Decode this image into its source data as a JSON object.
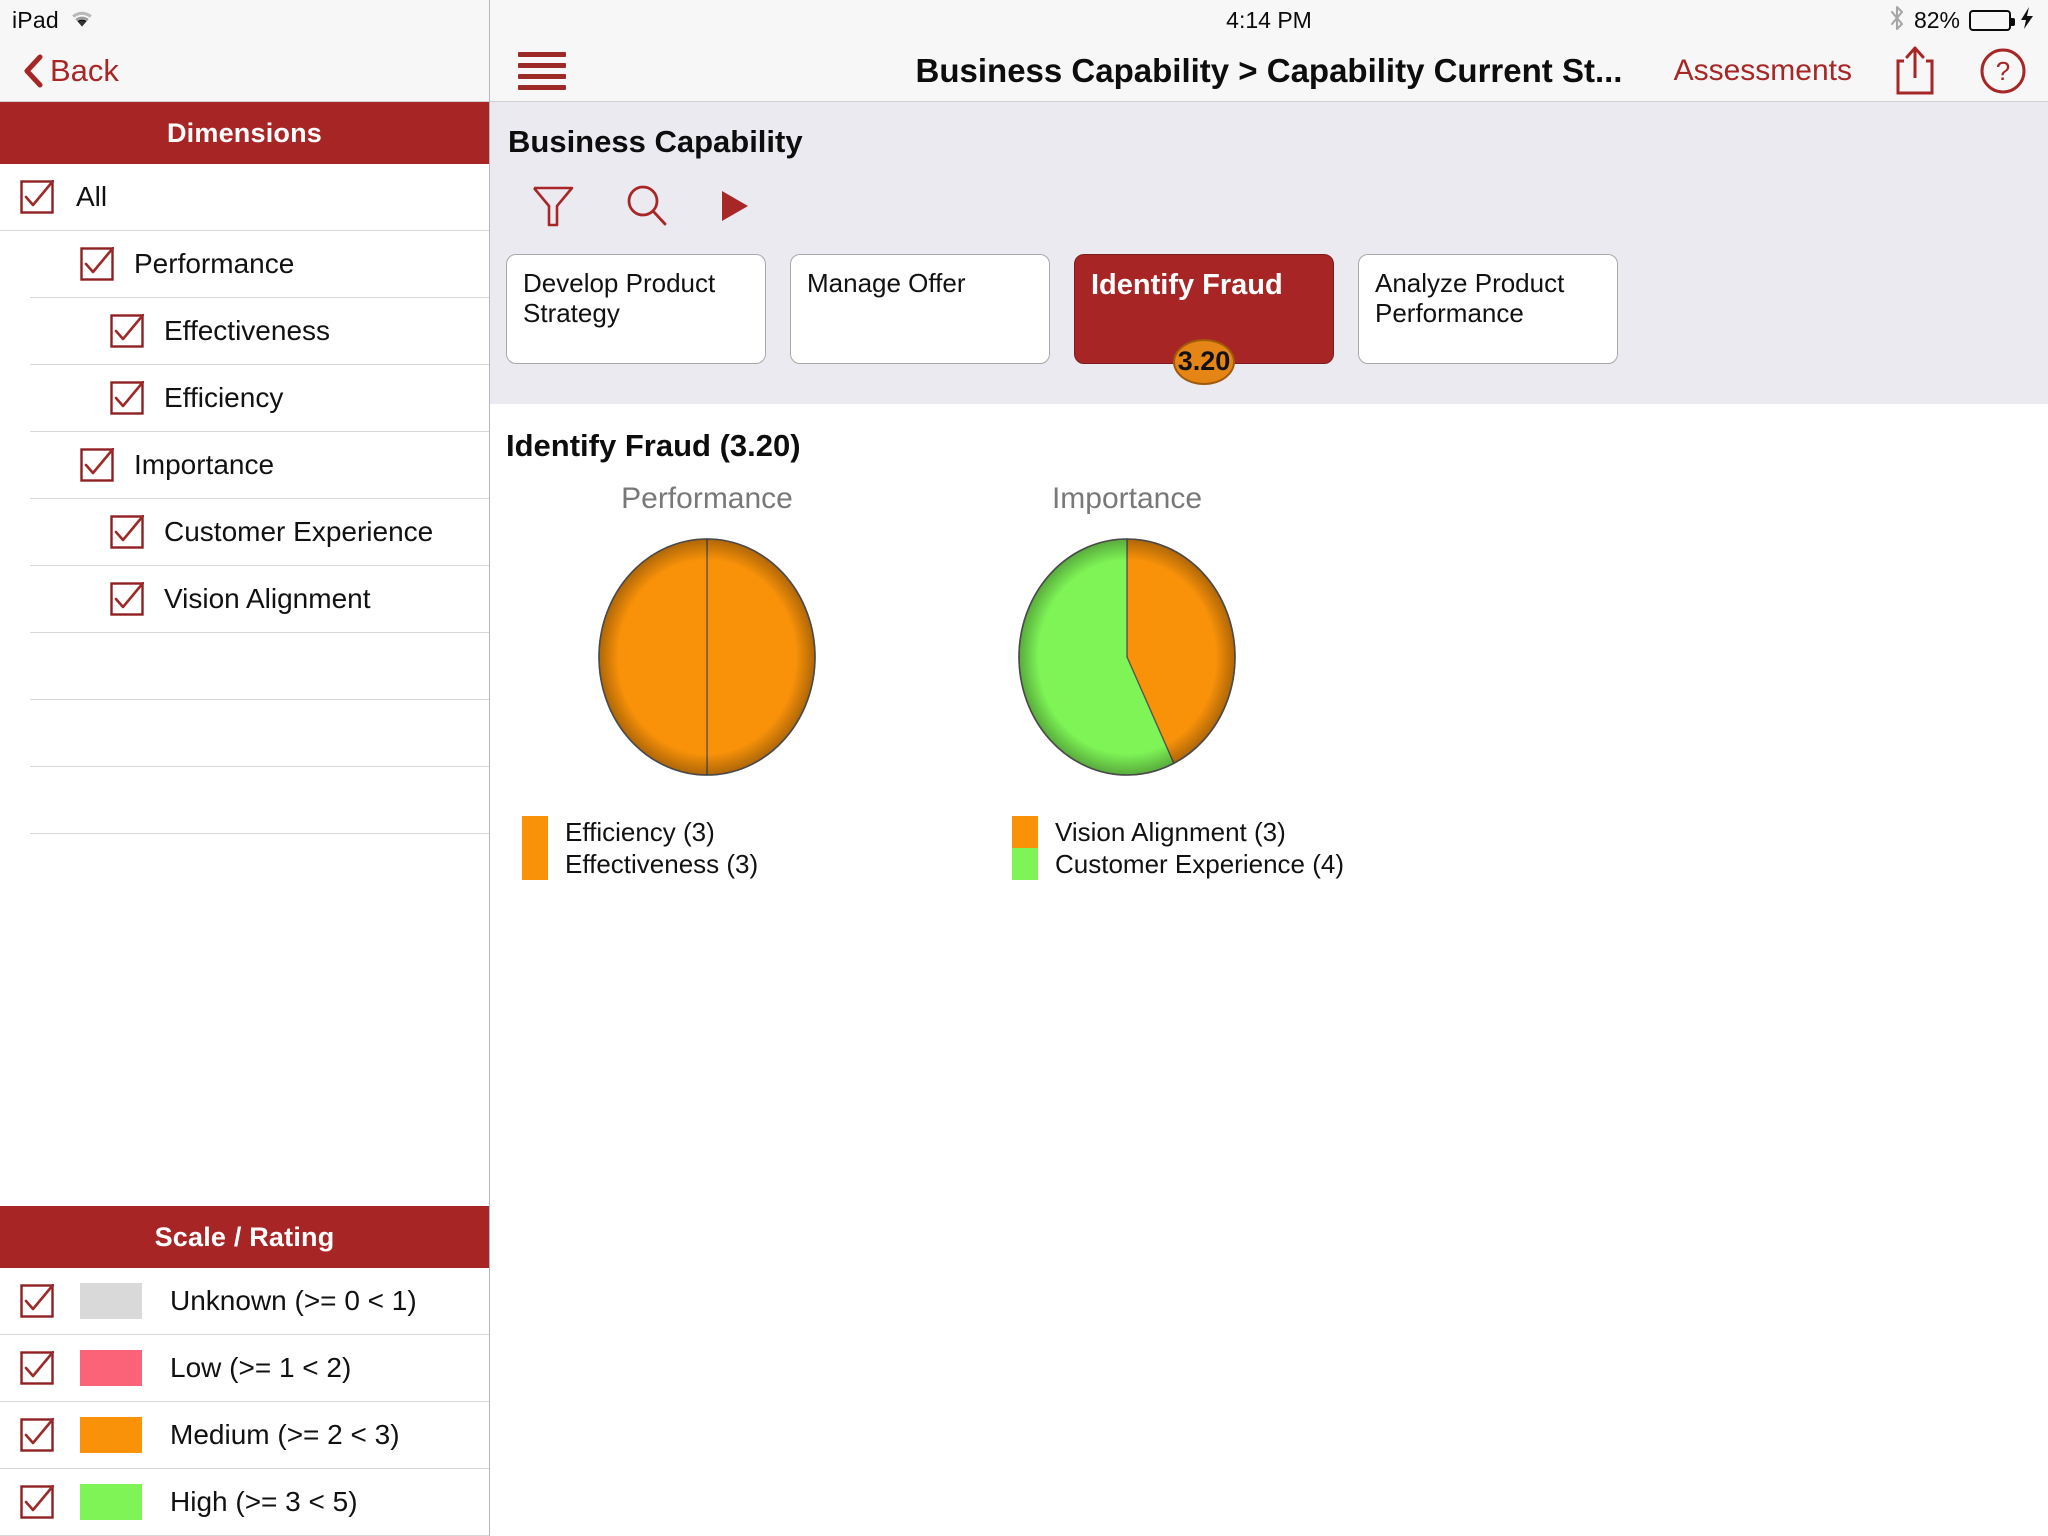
{
  "status_bar": {
    "carrier": "iPad",
    "wifi_icon": "wifi-icon",
    "time": "4:14 PM",
    "bluetooth_icon": "bluetooth-icon",
    "battery_percent": "82%",
    "battery_level": 82,
    "charging_icon": "lightning-bolt-icon"
  },
  "left_pane": {
    "back_label": "Back",
    "dimensions_header": "Dimensions",
    "dimension_items": [
      {
        "label": "All",
        "indent": 0,
        "checked": true
      },
      {
        "label": "Performance",
        "indent": 1,
        "checked": true
      },
      {
        "label": "Effectiveness",
        "indent": 2,
        "checked": true
      },
      {
        "label": "Efficiency",
        "indent": 2,
        "checked": true
      },
      {
        "label": "Importance",
        "indent": 1,
        "checked": true
      },
      {
        "label": "Customer Experience",
        "indent": 2,
        "checked": true
      },
      {
        "label": "Vision Alignment",
        "indent": 2,
        "checked": true
      }
    ],
    "blank_rows": 3,
    "scale_header": "Scale / Rating",
    "scale_items": [
      {
        "label": "Unknown (>= 0 < 1)",
        "color": "#d9d9d9",
        "checked": true
      },
      {
        "label": "Low (>= 1 < 2)",
        "color": "#fa6378",
        "checked": true
      },
      {
        "label": "Medium (>= 2 < 3)",
        "color": "#f99209",
        "checked": true
      },
      {
        "label": "High (>= 3 < 5)",
        "color": "#7ef456",
        "checked": true
      }
    ]
  },
  "right_pane": {
    "menu_icon": "hamburger-menu-icon",
    "nav_title": "Business Capability > Capability Current St...",
    "assessments_label": "Assessments",
    "share_icon": "share-icon",
    "help_icon": "help-icon",
    "sub_title": "Business Capability",
    "toolbar": {
      "filter_icon": "filter-icon",
      "search_icon": "search-icon",
      "play_icon": "play-icon"
    },
    "capability_cards": [
      {
        "label": "Develop Product Strategy",
        "selected": false,
        "score": null
      },
      {
        "label": "Manage Offer",
        "selected": false,
        "score": null
      },
      {
        "label": "Identify Fraud",
        "selected": true,
        "score": "3.20"
      },
      {
        "label": "Analyze Product Performance",
        "selected": false,
        "score": null
      }
    ]
  },
  "chart_data": [
    {
      "type": "pie",
      "title": "Identify Fraud (3.20)",
      "subtitle": "Performance",
      "legend_position": "bottom",
      "labels": [
        "Efficiency (3)",
        "Effectiveness (3)"
      ],
      "values": [
        3,
        3
      ],
      "colors": [
        "#f99209",
        "#f99209"
      ]
    },
    {
      "type": "pie",
      "title": "Identify Fraud (3.20)",
      "subtitle": "Importance",
      "legend_position": "bottom",
      "labels": [
        "Vision Alignment (3)",
        "Customer Experience (4)"
      ],
      "values": [
        3,
        4
      ],
      "colors": [
        "#f99209",
        "#7ef456"
      ]
    }
  ]
}
